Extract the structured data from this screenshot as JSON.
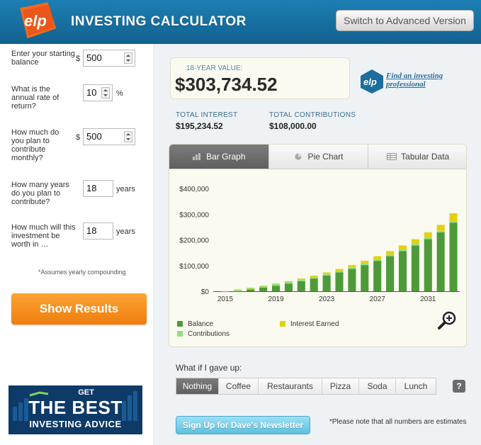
{
  "header": {
    "logo_text": "elp",
    "title": "INVESTING CALCULATOR",
    "advanced_button": "Switch to Advanced Version"
  },
  "form": {
    "starting_balance": {
      "label": "Enter your starting balance",
      "prefix": "$",
      "value": "500"
    },
    "annual_rate": {
      "label": "What is the annual rate of return?",
      "value": "10",
      "suffix": "%"
    },
    "monthly_contribution": {
      "label": "How much do you plan to contribute monthly?",
      "prefix": "$",
      "value": "500"
    },
    "years_contribute": {
      "label": "How many years do you plan to contribute?",
      "value": "18",
      "suffix": "years"
    },
    "years_worth": {
      "label": "How much will this investment be worth in …",
      "value": "18",
      "suffix": "years"
    },
    "note": "*Assumes yearly compounding",
    "submit_label": "Show Results"
  },
  "ad": {
    "line1": "GET",
    "line2": "THE BEST",
    "line3": "INVESTING ADVICE"
  },
  "results": {
    "value_label": "18-YEAR VALUE:",
    "value_amount": "$303,734.52",
    "find_pro_link": "Find an investing professional",
    "total_interest_label": "TOTAL INTEREST",
    "total_interest_value": "$195,234.52",
    "total_contributions_label": "TOTAL CONTRIBUTIONS",
    "total_contributions_value": "$108,000.00"
  },
  "tabs": [
    {
      "label": "Bar Graph",
      "icon": "bar-chart-icon",
      "active": true
    },
    {
      "label": "Pie Chart",
      "icon": "pie-chart-icon",
      "active": false
    },
    {
      "label": "Tabular Data",
      "icon": "table-icon",
      "active": false
    }
  ],
  "legend": {
    "balance": "Balance",
    "contributions": "Contributions",
    "interest": "Interest Earned"
  },
  "colors": {
    "balance": "#4e9a3a",
    "contributions": "#8fe07e",
    "interest": "#e2d10f",
    "header": "#1d7fb4",
    "button_orange": "#f58a1f"
  },
  "chart_data": {
    "type": "bar",
    "x": [
      2015,
      2016,
      2017,
      2018,
      2019,
      2020,
      2021,
      2022,
      2023,
      2024,
      2025,
      2026,
      2027,
      2028,
      2029,
      2030,
      2031,
      2032,
      2033
    ],
    "x_tick_labels": [
      "2015",
      "2019",
      "2023",
      "2027",
      "2031"
    ],
    "y_tick_labels": [
      "$0",
      "$100,000",
      "$200,000",
      "$300,000",
      "$400,000"
    ],
    "ylim": [
      0,
      400000
    ],
    "stacked": true,
    "series": [
      {
        "name": "Balance",
        "values": [
          0,
          500,
          6800,
          13800,
          21500,
          30000,
          39300,
          49500,
          60800,
          73200,
          86800,
          101800,
          118300,
          136400,
          156400,
          178400,
          202600,
          229200,
          267000
        ]
      },
      {
        "name": "Contributions",
        "values": [
          500,
          6000,
          6000,
          6000,
          6000,
          6000,
          6000,
          6000,
          6000,
          6000,
          6000,
          6000,
          6000,
          6000,
          6000,
          6000,
          6000,
          6000,
          6000
        ]
      },
      {
        "name": "Interest Earned",
        "values": [
          0,
          300,
          1000,
          1700,
          2500,
          3300,
          4200,
          5300,
          6400,
          7600,
          9000,
          10500,
          12100,
          14000,
          16000,
          18200,
          20600,
          23300,
          30700
        ]
      }
    ],
    "legend_position": "bottom",
    "grid": false
  },
  "whatif": {
    "label": "What if I gave up:",
    "options": [
      "Nothing",
      "Coffee",
      "Restaurants",
      "Pizza",
      "Soda",
      "Lunch"
    ],
    "selected": "Nothing",
    "help": "?"
  },
  "newsletter_button": "Sign Up for Dave's Newsletter",
  "estimate_note": "*Please note that all numbers are estimates"
}
